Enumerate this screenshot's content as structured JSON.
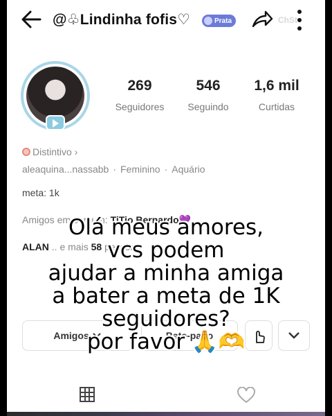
{
  "header": {
    "username": "@♧Lindinha fofis♡",
    "badge_label": "Prata",
    "watermark": "ChSt"
  },
  "profile": {
    "stats": [
      {
        "value": "269",
        "label": "Seguidores"
      },
      {
        "value": "546",
        "label": "Seguindo"
      },
      {
        "value": "1,6 mil",
        "label": "Curtidas"
      }
    ],
    "distintivo": "Distintivo ›",
    "info": [
      "aleaquina...nassabb",
      "Feminino",
      "Aquário"
    ],
    "meta": "meta: 1k",
    "mutual_prefix": "Amigos em comum:",
    "mutual_friend_1": "TiTio Bernardo",
    "mutual_friend_1_mark": "💜",
    "mutual_friend_2": "ALAN",
    "mutual_and_more": "e mais",
    "mutual_count": "58",
    "mutual_people": "pessoas"
  },
  "actions": {
    "friends_label": "Amigos",
    "chat_label": "Bate-papo"
  },
  "overlay": {
    "lines": [
      "Olá meus amores,",
      "vcs podem",
      "ajudar a minha amiga",
      "a bater a meta de 1K",
      "seguidores?",
      "por favor 🙏🫶"
    ]
  },
  "colors": {
    "badge": "#6c7bd8",
    "avatar_ring": "#a9d6e8",
    "text_muted": "#888888"
  }
}
